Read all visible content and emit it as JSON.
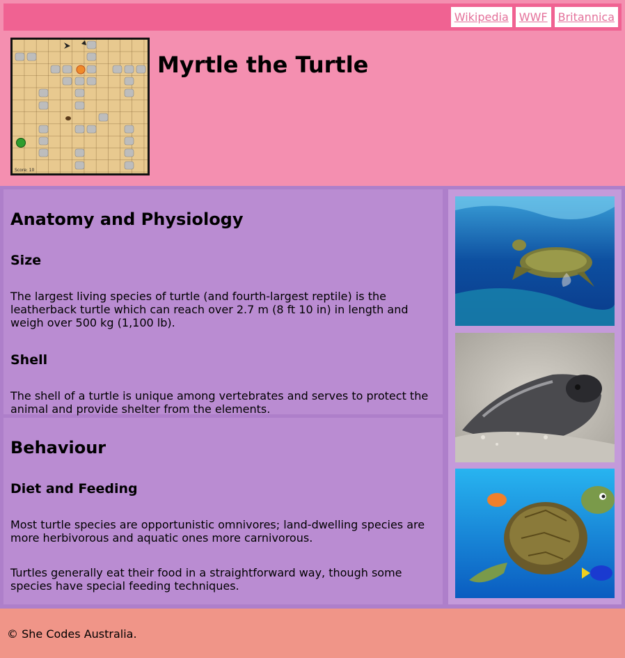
{
  "header": {
    "title": "Myrtle the Turtle",
    "nav": [
      "Wikipedia",
      "WWF",
      "Britannica"
    ],
    "game_score": "Score: 10"
  },
  "anatomy": {
    "heading": "Anatomy and Physiology",
    "size_heading": "Size",
    "size_text": "The largest living species of turtle (and fourth-largest reptile) is the leatherback turtle which can reach over 2.7 m (8 ft 10 in) in length and weigh over 500 kg (1,100 lb).",
    "shell_heading": "Shell",
    "shell_text": "The shell of a turtle is unique among vertebrates and serves to protect the animal and provide shelter from the elements."
  },
  "behaviour": {
    "heading": "Behaviour",
    "diet_heading": "Diet and Feeding",
    "diet_text_1": "Most turtle species are opportunistic omnivores; land-dwelling species are more herbivorous and aquatic ones more carnivorous.",
    "diet_text_2": "Turtles generally eat their food in a straightforward way, though some species have special feeding techniques."
  },
  "footer": {
    "text": "© She Codes Australia."
  },
  "colors": {
    "header_bg": "#f48fb0",
    "nav_bg": "#f06292",
    "section_bg": "#ba8cd2",
    "footer_bg": "#f09588"
  },
  "images": [
    "sea-turtle-swimming",
    "baby-turtle-on-sand",
    "cartoon-turtle-and-fish"
  ]
}
